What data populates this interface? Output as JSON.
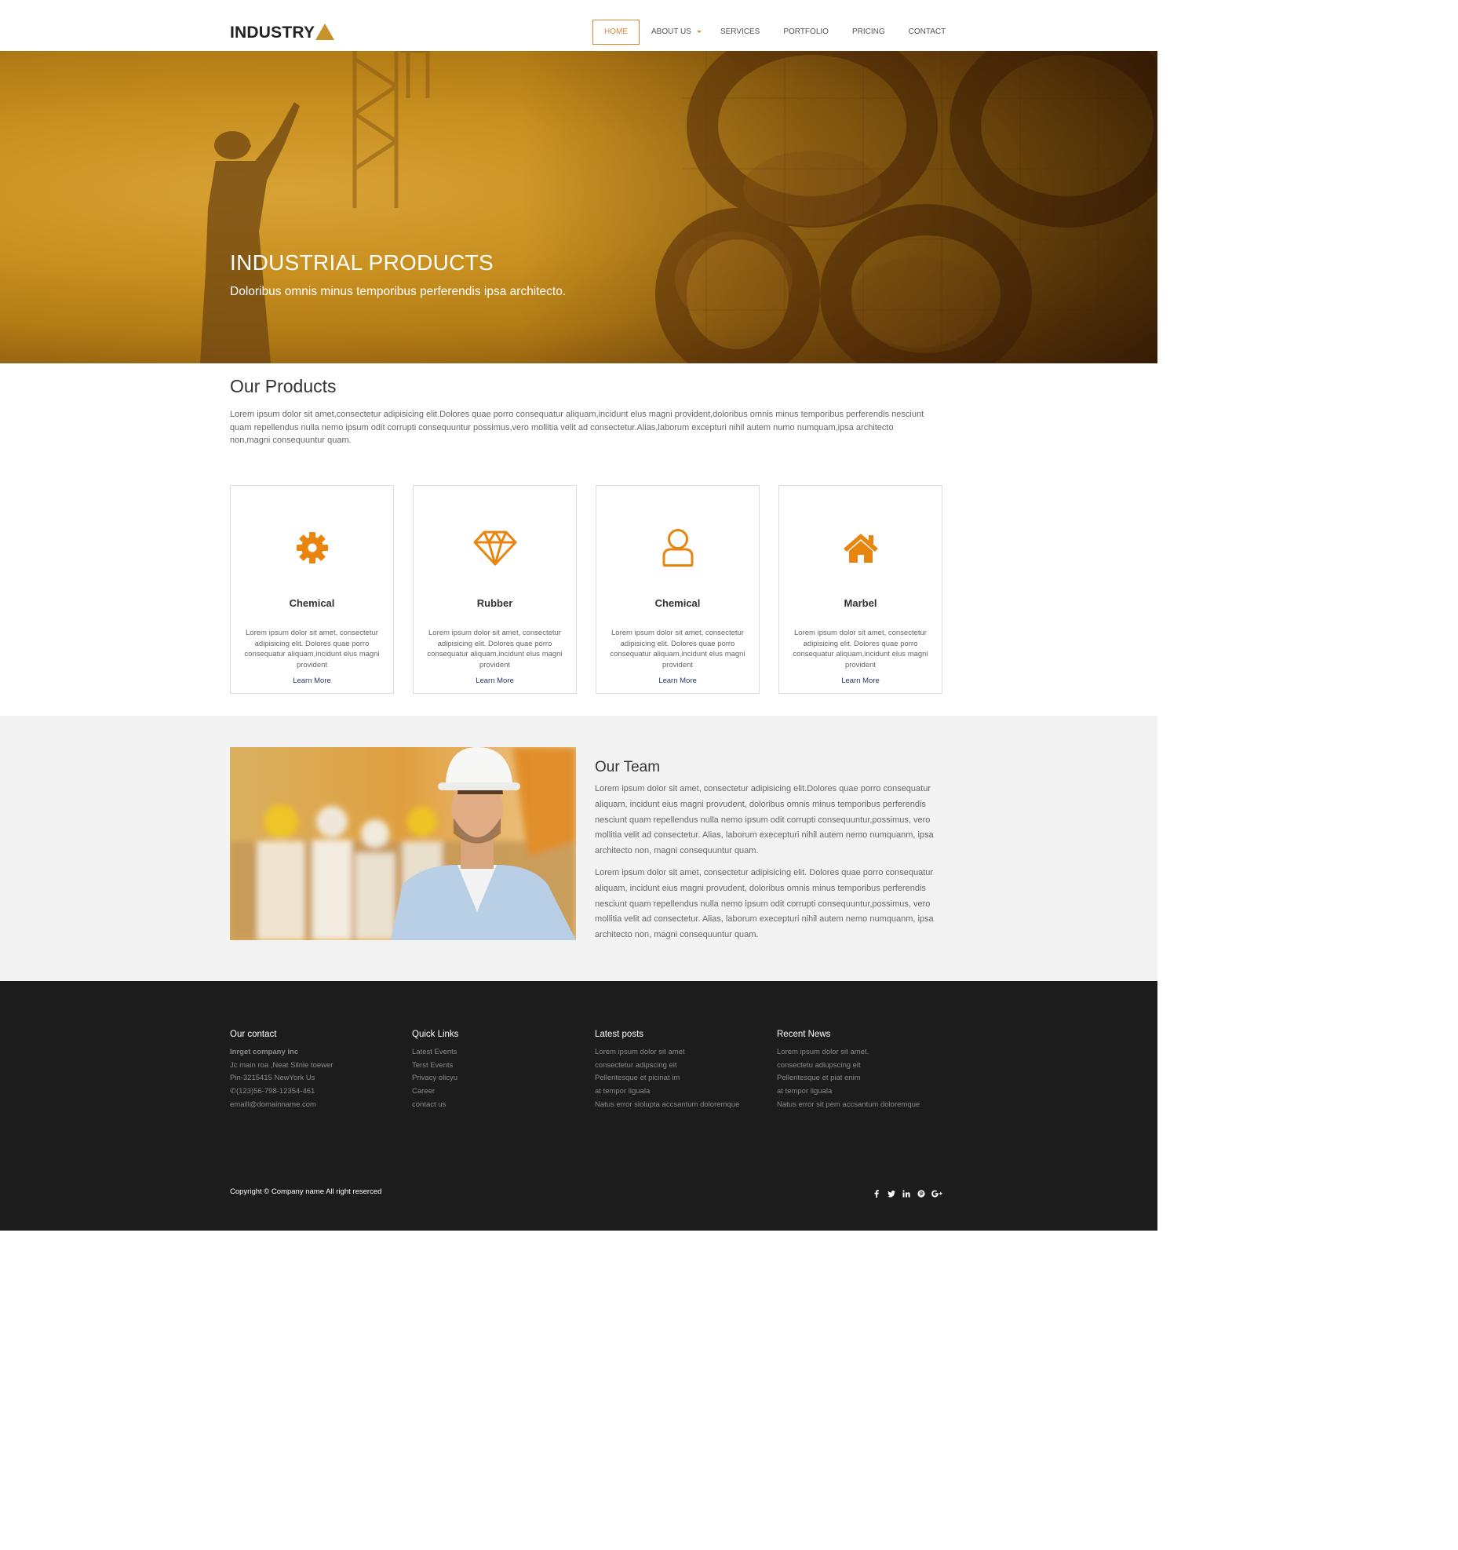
{
  "header": {
    "logo": "INDUSTRY",
    "nav": [
      {
        "label": "HOME",
        "active": true
      },
      {
        "label": "ABOUT US",
        "dropdown": true
      },
      {
        "label": "SERVICES"
      },
      {
        "label": "PORTFOLIO"
      },
      {
        "label": "PRICING"
      },
      {
        "label": "CONTACT"
      }
    ]
  },
  "hero": {
    "title": "INDUSTRIAL PRODUCTS",
    "subtitle": "Doloribus omnis minus temporibus perferendis ipsa architecto."
  },
  "products": {
    "title": "Our Products",
    "intro": "Lorem ipsum dolor sit amet,consectetur adipisicing elit.Dolores quae porro consequatur aliquam,incidunt elus magni provident,doloribus omnis minus temporibus perferendis nesciunt quam repellendus nulla nemo ipsum odit corrupti consequuntur possimus,vero mollitia velit ad consectetur.Alias,laborum excepturi nihil autem numo numquam,ipsa architecto non,magni consequuntur quam.",
    "cards": [
      {
        "icon": "gear-icon",
        "title": "Chemical",
        "text": "Lorem ipsum dolor sit amet, consectetur adipisicing elit. Dolores quae porro consequatur aliquam,incidunt elus magni provident",
        "link": "Learn More"
      },
      {
        "icon": "diamond-icon",
        "title": "Rubber",
        "text": "Lorem ipsum dolor sit amet, consectetur adipisicing elit. Dolores quae porro consequatur aliquam,incidunt elus magni provident",
        "link": "Learn More"
      },
      {
        "icon": "user-icon",
        "title": "Chemical",
        "text": "Lorem ipsum dolor sit amet, consectetur adipisicing elit. Dolores quae porro consequatur aliquam,incidunt elus magni provident",
        "link": "Learn More"
      },
      {
        "icon": "home-icon",
        "title": "Marbel",
        "text": "Lorem ipsum dolor sit amet, consectetur adipisicing elit. Dolores quae porro consequatur aliquam,incidunt elus magni provident",
        "link": "Learn More"
      }
    ]
  },
  "team": {
    "title": "Our Team",
    "p1": "Lorem ipsum dolor sit amet, consectetur adipisicing elit.Dolores quae porro consequatur aliquam, incidunt eius magni provudent, doloribus omnis minus temporibus perferendis nesciunt quam repellendus nulla nemo ipsum odit corrupti consequuntur,possimus, vero mollitia velit ad consectetur. Alias, laborum execepturi nihil autem nemo numquanm, ipsa architecto non, magni consequuntur quam.",
    "p2": "Lorem ipsum dolor sit amet, consectetur adipisicing elit. Dolores quae porro consequatur aliquam, incidunt eius magni provudent, doloribus omnis minus temporibus perferendis nesciunt quam repellendus nulla nemo ipsum odit corrupti consequuntur,possimus, vero mollitia velit ad consectetur. Alias, laborum execepturi nihil autem nemo numquanm, ipsa architecto non, magni consequuntur quam."
  },
  "footer": {
    "contact": {
      "title": "Our contact",
      "company": "Inrget company inc",
      "address": "Jc main roa ,Neat Silnle toewer",
      "pin": "Pin-3215415 NewYork Us",
      "phone": "(123)56-798-12354-461",
      "email": "emaill@domainname.com"
    },
    "quick_links": {
      "title": "Quick Links",
      "items": [
        "Latest Events",
        "Terst Events",
        "Privacy olicyu",
        "Career",
        "contact us"
      ]
    },
    "latest_posts": {
      "title": "Latest posts",
      "items": [
        "Lorem ipsum dolor sit amet",
        "consectetur adipscing eit",
        "Pellentesque et picinat im",
        "at tempor liguala",
        "Natus error siolupta accsantum doloremque"
      ]
    },
    "recent_news": {
      "title": "Recent News",
      "items": [
        "Lorem ipsum dolor sit amet.",
        "consectetu adiupscing elt",
        "Pellentesque et piat enim",
        "at tempor liguala",
        "Natus error sit pem accsantum doloremque"
      ]
    },
    "copyright": "Copyright © Company name All right reserced",
    "social": [
      "facebook-icon",
      "twitter-icon",
      "linkedin-icon",
      "pinterest-icon",
      "google-plus-icon"
    ]
  },
  "colors": {
    "accent": "#d9893a",
    "icon_orange": "#e8850f",
    "logo_triangle": "#c8922a",
    "footer_bg": "#1c1c1c",
    "team_bg": "#f3f3f3",
    "link_blue": "#2c3a6b"
  }
}
